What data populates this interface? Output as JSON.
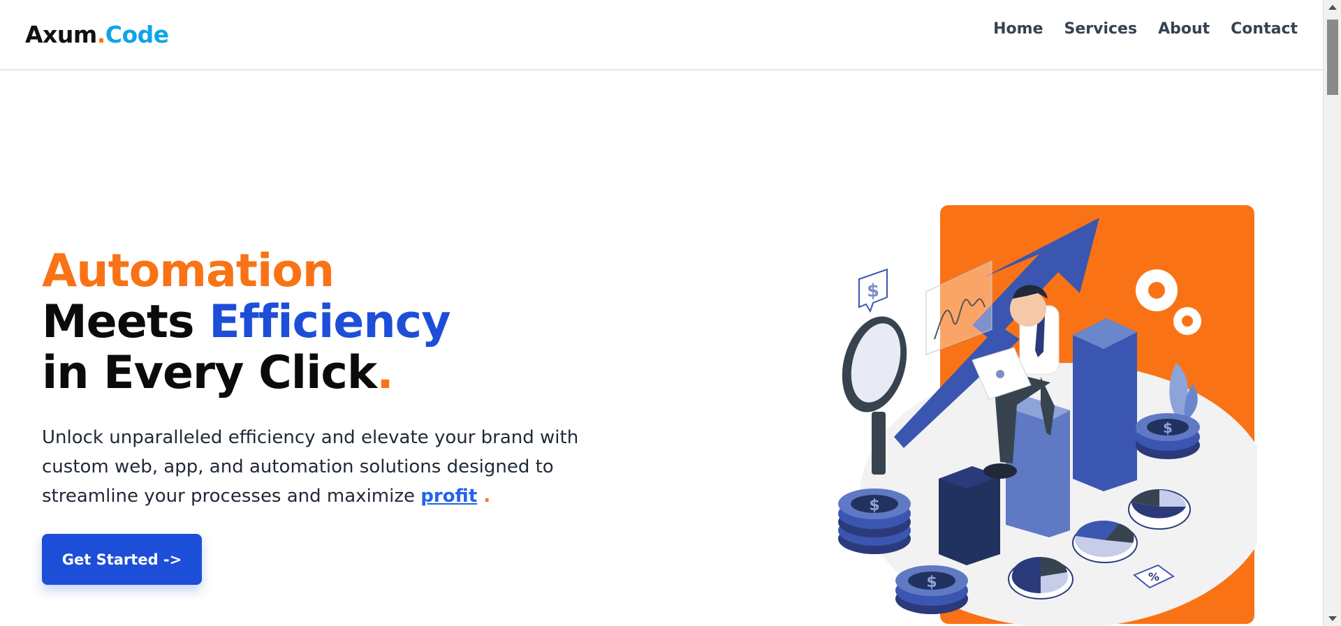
{
  "header": {
    "logo": {
      "part1": "Axum",
      "dot": ".",
      "part2": "Code"
    },
    "nav": [
      "Home",
      "Services",
      "About",
      "Contact"
    ]
  },
  "hero": {
    "title_line1": "Automation",
    "title_line2_a": "Meets ",
    "title_line2_b": "Efficiency",
    "title_line3": "in Every Click",
    "title_period": ".",
    "description": "Unlock unparalleled efficiency and elevate your brand with custom web, app, and automation solutions designed to streamline your processes and maximize ",
    "highlight": "profit",
    "end_dot": " .",
    "cta_label": "Get Started ->"
  },
  "illustration": {
    "badge_percent": "%",
    "coin_symbol": "$"
  },
  "colors": {
    "orange": "#f97316",
    "blue": "#1d4ed8",
    "sky": "#0ea5e9",
    "navy": "#2b3a7a"
  }
}
